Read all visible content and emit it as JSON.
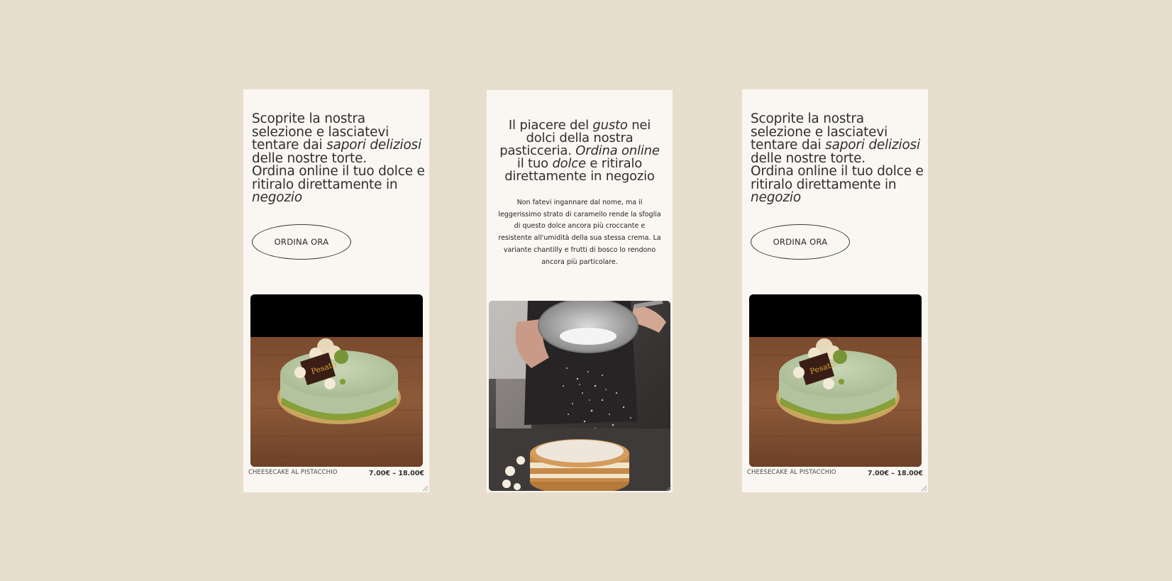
{
  "cards": [
    {
      "heading_lines": [
        {
          "pre": "Scoprite la nostra",
          "em": "",
          "post": ""
        },
        {
          "pre": "selezione e lasciatevi",
          "em": "",
          "post": ""
        },
        {
          "pre": "tentare dai ",
          "em": "sapori deliziosi",
          "post": ""
        },
        {
          "pre": "delle nostre torte.",
          "em": "",
          "post": ""
        },
        {
          "pre": "Ordina online il tuo dolce e",
          "em": "",
          "post": ""
        },
        {
          "pre": "ritiralo direttamente in",
          "em": "",
          "post": ""
        },
        {
          "pre": "",
          "em": "negozio",
          "post": ""
        }
      ],
      "button_label": "ORDINA ORA",
      "product_name": "CHEESECAKE AL PISTACCHIO",
      "product_price": "7.00€ – 18.00€"
    },
    {
      "heading_lines": [
        {
          "pre": "Scoprite la nostra",
          "em": "",
          "post": ""
        },
        {
          "pre": "selezione e lasciatevi",
          "em": "",
          "post": ""
        },
        {
          "pre": "tentare dai ",
          "em": "sapori deliziosi",
          "post": ""
        },
        {
          "pre": "delle nostre torte.",
          "em": "",
          "post": ""
        },
        {
          "pre": "Ordina online il tuo dolce e",
          "em": "",
          "post": ""
        },
        {
          "pre": "ritiralo direttamente in",
          "em": "",
          "post": ""
        },
        {
          "pre": "",
          "em": "negozio",
          "post": ""
        }
      ],
      "button_label": "ORDINA ORA",
      "product_name": "CHEESECAKE AL PISTACCHIO",
      "product_price": "7.00€ – 18.00€"
    }
  ],
  "center": {
    "heading_lines": [
      {
        "pre": "Il piacere del ",
        "em": "gusto",
        "post": " nei"
      },
      {
        "pre": "dolci della nostra",
        "em": "",
        "post": ""
      },
      {
        "pre": "pasticceria. ",
        "em": "Ordina online",
        "post": ""
      },
      {
        "pre": "il tuo ",
        "em": "dolce",
        "post": " e ritiralo"
      },
      {
        "pre": "direttamente in negozio",
        "em": "",
        "post": ""
      }
    ],
    "body_lines": [
      "Non fatevi ingannare dal nome, ma il",
      "leggerissimo strato di caramello rende la sfoglia",
      "di questo dolce ancora più croccante e",
      "resistente all'umidità della sua stessa crema. La",
      "variante chantilly e frutti di bosco lo rendono",
      "ancora più particolare."
    ]
  },
  "colors": {
    "background": "#e8dece",
    "card": "#faf7f2",
    "text": "#2f2f2f"
  },
  "cake_logo_text": "Pesato"
}
